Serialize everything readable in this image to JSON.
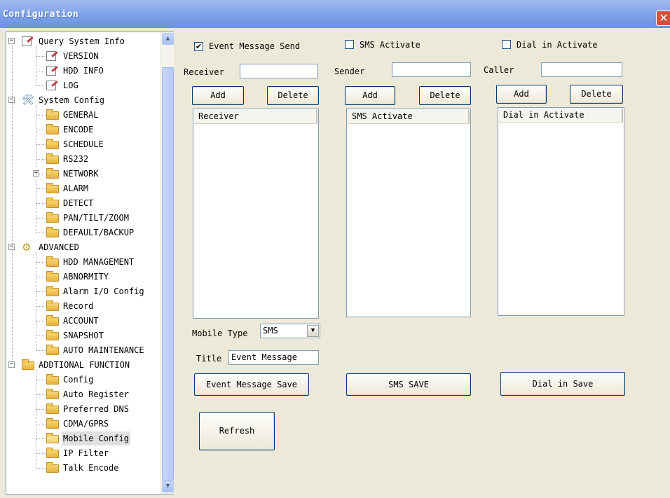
{
  "window": {
    "title": "Configuration",
    "close_glyph": "✕"
  },
  "tree": {
    "items": [
      {
        "label": "Query System Info",
        "icon": "doc-icon",
        "level": 0,
        "expander": "−"
      },
      {
        "label": "VERSION",
        "icon": "doc-icon",
        "level": 1
      },
      {
        "label": "HDD INFO",
        "icon": "doc-icon",
        "level": 1
      },
      {
        "label": "LOG",
        "icon": "doc-icon",
        "level": 1
      },
      {
        "label": "System Config",
        "icon": "tool-icon",
        "level": 0,
        "expander": "−"
      },
      {
        "label": "GENERAL",
        "icon": "folder-icon",
        "level": 1
      },
      {
        "label": "ENCODE",
        "icon": "folder-icon",
        "level": 1
      },
      {
        "label": "SCHEDULE",
        "icon": "folder-icon",
        "level": 1
      },
      {
        "label": "RS232",
        "icon": "folder-icon",
        "level": 1
      },
      {
        "label": "NETWORK",
        "icon": "folder-icon",
        "level": 1,
        "expander": "+"
      },
      {
        "label": "ALARM",
        "icon": "folder-icon",
        "level": 1
      },
      {
        "label": "DETECT",
        "icon": "folder-icon",
        "level": 1
      },
      {
        "label": "PAN/TILT/ZOOM",
        "icon": "folder-icon",
        "level": 1
      },
      {
        "label": "DEFAULT/BACKUP",
        "icon": "folder-icon",
        "level": 1
      },
      {
        "label": "ADVANCED",
        "icon": "gear-icon",
        "level": 0,
        "expander": "−"
      },
      {
        "label": "HDD MANAGEMENT",
        "icon": "folder-icon",
        "level": 1
      },
      {
        "label": "ABNORMITY",
        "icon": "folder-icon",
        "level": 1
      },
      {
        "label": "Alarm I/O Config",
        "icon": "folder-icon",
        "level": 1
      },
      {
        "label": "Record",
        "icon": "folder-icon",
        "level": 1
      },
      {
        "label": "ACCOUNT",
        "icon": "folder-icon",
        "level": 1
      },
      {
        "label": "SNAPSHOT",
        "icon": "folder-icon",
        "level": 1
      },
      {
        "label": "AUTO MAINTENANCE",
        "icon": "folder-icon",
        "level": 1
      },
      {
        "label": "ADDTIONAL FUNCTION",
        "icon": "folder-icon",
        "level": 0,
        "expander": "−"
      },
      {
        "label": "Config",
        "icon": "folder-icon",
        "level": 1
      },
      {
        "label": "Auto Register",
        "icon": "folder-icon",
        "level": 1
      },
      {
        "label": "Preferred DNS",
        "icon": "folder-icon",
        "level": 1
      },
      {
        "label": "CDMA/GPRS",
        "icon": "folder-icon",
        "level": 1
      },
      {
        "label": "Mobile Config",
        "icon": "open-folder-icon",
        "level": 1,
        "selected": true
      },
      {
        "label": "IP Filter",
        "icon": "folder-icon",
        "level": 1
      },
      {
        "label": "Talk Encode",
        "icon": "folder-icon",
        "level": 1
      }
    ],
    "scroll_up": "▲",
    "scroll_down": "▼"
  },
  "event": {
    "checkbox_label": "Event Message Send",
    "checked": true,
    "receiver_label": "Receiver",
    "receiver_value": "",
    "add_label": "Add",
    "delete_label": "Delete",
    "list_header": "Receiver",
    "mobile_type_label": "Mobile Type",
    "mobile_type_value": "SMS",
    "title_label": "Title",
    "title_value": "Event Message",
    "save_label": "Event Message Save"
  },
  "sms": {
    "checkbox_label": "SMS Activate",
    "checked": false,
    "sender_label": "Sender",
    "sender_value": "",
    "add_label": "Add",
    "delete_label": "Delete",
    "list_header": "SMS Activate",
    "save_label": "SMS SAVE"
  },
  "dial": {
    "checkbox_label": "Dial in Activate",
    "checked": false,
    "caller_label": "Caller",
    "caller_value": "",
    "add_label": "Add",
    "delete_label": "Delete",
    "list_header": "Dial in Activate",
    "save_label": "Dial in Save"
  },
  "refresh_label": "Refresh",
  "check_glyph": "✔",
  "colors": {
    "titlebar": "#7b9fe6",
    "close": "#d8503a",
    "background": "#ece9d8"
  }
}
